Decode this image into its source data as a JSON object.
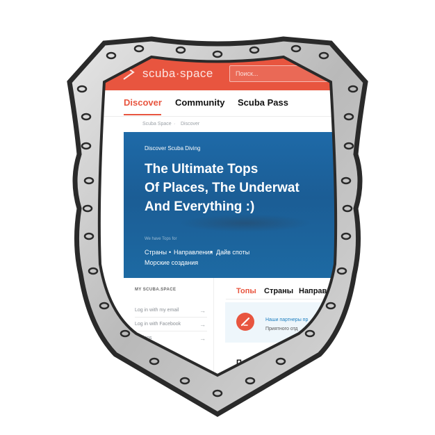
{
  "header": {
    "logo_text": "scuba·space",
    "search_placeholder": "Поиск..."
  },
  "nav": {
    "items": [
      {
        "label": "Discover",
        "active": true
      },
      {
        "label": "Community",
        "active": false
      },
      {
        "label": "Scuba Pass",
        "active": false
      }
    ]
  },
  "breadcrumb": {
    "items": [
      "Scuba Space",
      "Discover"
    ]
  },
  "hero": {
    "eyebrow": "Discover Scuba Diving",
    "title_lines": [
      "The Ultimate Tops",
      "Of Places, The Underwat",
      "And Everything :)"
    ],
    "subtext": "We have Tops for",
    "links": [
      "Страны",
      "Направления",
      "Дайв споты",
      "Морские создания"
    ]
  },
  "sidebar": {
    "heading": "MY SCUBA.SPACE",
    "rows": [
      "Log in with my email",
      "Log in with Facebook",
      "...ations"
    ]
  },
  "content_tabs": {
    "items": [
      {
        "label": "Топы",
        "active": true
      },
      {
        "label": "Страны",
        "active": false
      },
      {
        "label": "Направлен",
        "active": false
      }
    ]
  },
  "partner_card": {
    "title": "Наши партнеры пр",
    "text": "Приятного отд"
  },
  "section": {
    "heading": "П"
  },
  "colors": {
    "brand": "#e8553f",
    "hero_blue": "#1e6aa8",
    "link_blue": "#1e7fc0",
    "frame_metal": "#c7c7c7"
  },
  "icons": {
    "logo": "scuba-space-logo-icon",
    "arrow": "chevron-right-icon",
    "partner": "no-entry-icon"
  }
}
